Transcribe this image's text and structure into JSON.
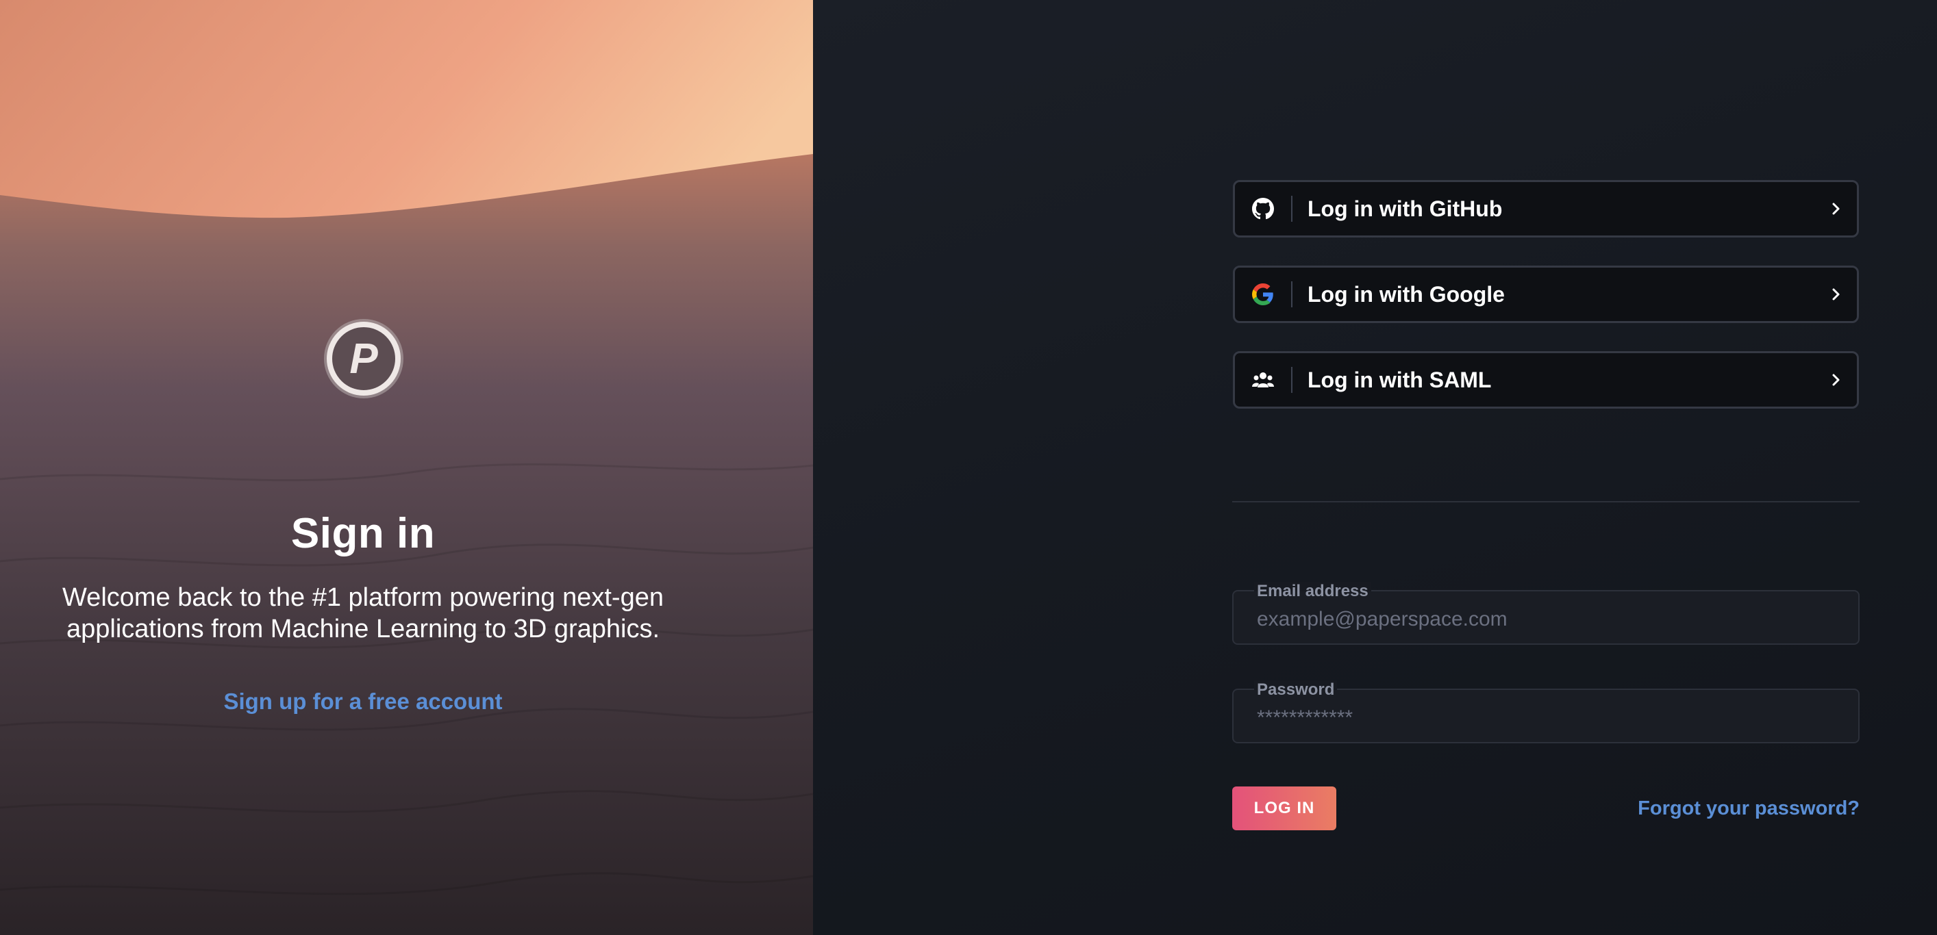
{
  "hero": {
    "title": "Sign in",
    "subtitle": "Welcome back to the #1 platform powering next-gen applications from Machine Learning to 3D graphics.",
    "signup_link": "Sign up for a free account",
    "logo_icon": "paperspace-logo-icon",
    "logo_letter": "P"
  },
  "oauth": [
    {
      "label": "Log in with GitHub",
      "icon": "github-icon"
    },
    {
      "label": "Log in with Google",
      "icon": "google-icon"
    },
    {
      "label": "Log in with SAML",
      "icon": "saml-users-icon"
    }
  ],
  "form": {
    "email": {
      "label": "Email address",
      "placeholder": "example@paperspace.com",
      "value": ""
    },
    "password": {
      "label": "Password",
      "placeholder": "************",
      "value": ""
    },
    "login_label": "LOG IN",
    "forgot_label": "Forgot your password?"
  },
  "colors": {
    "link": "#5b8fd6",
    "login_gradient_start": "#e3527a",
    "login_gradient_end": "#ea7d63",
    "panel_bg": "#161a21"
  }
}
